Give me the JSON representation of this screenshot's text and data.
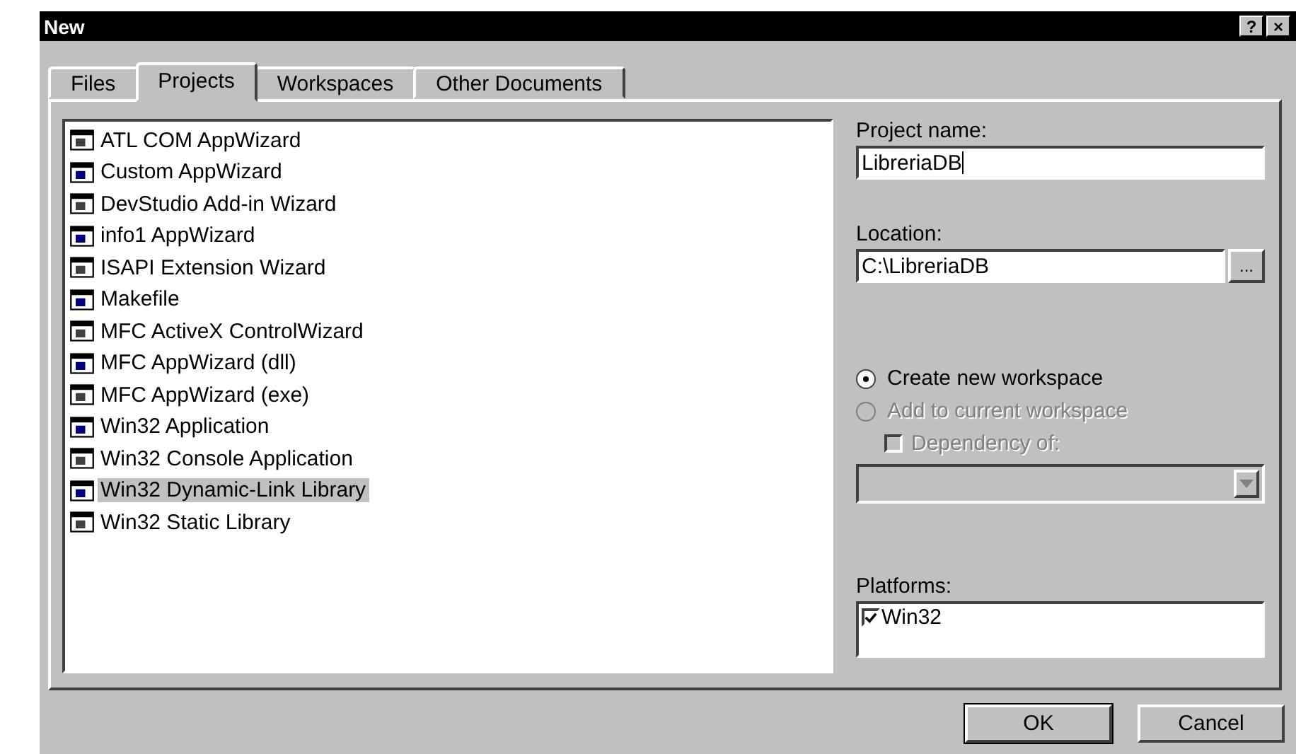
{
  "window": {
    "title": "New",
    "help_button": "?",
    "close_button": "×"
  },
  "tabs": [
    {
      "label": "Files",
      "selected": false
    },
    {
      "label": "Projects",
      "selected": true
    },
    {
      "label": "Workspaces",
      "selected": false
    },
    {
      "label": "Other Documents",
      "selected": false
    }
  ],
  "project_types": [
    {
      "label": "ATL COM AppWizard",
      "selected": false
    },
    {
      "label": "Custom AppWizard",
      "selected": false
    },
    {
      "label": "DevStudio Add-in Wizard",
      "selected": false
    },
    {
      "label": "info1 AppWizard",
      "selected": false
    },
    {
      "label": "ISAPI Extension Wizard",
      "selected": false
    },
    {
      "label": "Makefile",
      "selected": false
    },
    {
      "label": "MFC ActiveX ControlWizard",
      "selected": false
    },
    {
      "label": "MFC AppWizard (dll)",
      "selected": false
    },
    {
      "label": "MFC AppWizard (exe)",
      "selected": false
    },
    {
      "label": "Win32 Application",
      "selected": false
    },
    {
      "label": "Win32 Console Application",
      "selected": false
    },
    {
      "label": "Win32 Dynamic-Link Library",
      "selected": true
    },
    {
      "label": "Win32 Static Library",
      "selected": false
    }
  ],
  "project_name": {
    "label": "Project name:",
    "value": "LibreriaDB"
  },
  "location": {
    "label": "Location:",
    "value": "C:\\LibreriaDB",
    "browse_button": "..."
  },
  "workspace_options": [
    {
      "label": "Create new workspace",
      "selected": true,
      "disabled": false
    },
    {
      "label": "Add to current workspace",
      "selected": false,
      "disabled": true
    }
  ],
  "dependency": {
    "label": "Dependency of:",
    "checked": false,
    "disabled": true
  },
  "platforms": {
    "label": "Platforms:",
    "items": [
      {
        "label": "Win32",
        "checked": true
      }
    ]
  },
  "buttons": [
    {
      "label": "OK",
      "default": true
    },
    {
      "label": "Cancel",
      "default": false
    }
  ]
}
